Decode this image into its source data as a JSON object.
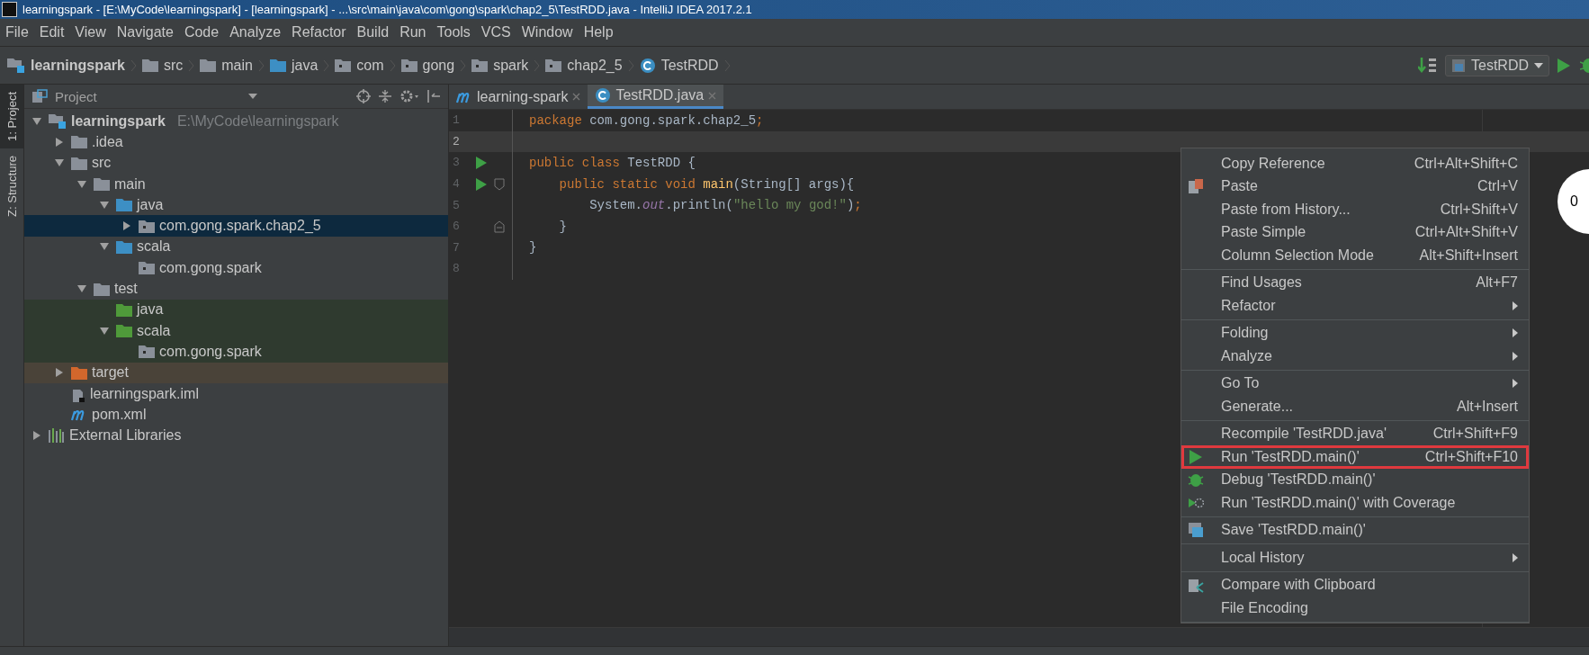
{
  "window": {
    "title": "learningspark - [E:\\MyCode\\learningspark] - [learningspark] - ...\\src\\main\\java\\com\\gong\\spark\\chap2_5\\TestRDD.java - IntelliJ IDEA 2017.2.1"
  },
  "menu": [
    "File",
    "Edit",
    "View",
    "Navigate",
    "Code",
    "Analyze",
    "Refactor",
    "Build",
    "Run",
    "Tools",
    "VCS",
    "Window",
    "Help"
  ],
  "breadcrumbs": [
    {
      "label": "learningspark",
      "kind": "module"
    },
    {
      "label": "src",
      "kind": "folder"
    },
    {
      "label": "main",
      "kind": "folder"
    },
    {
      "label": "java",
      "kind": "source"
    },
    {
      "label": "com",
      "kind": "package"
    },
    {
      "label": "gong",
      "kind": "package"
    },
    {
      "label": "spark",
      "kind": "package"
    },
    {
      "label": "chap2_5",
      "kind": "package"
    },
    {
      "label": "TestRDD",
      "kind": "class"
    }
  ],
  "run_config": {
    "label": "TestRDD"
  },
  "side_tabs": [
    {
      "label": "1: Project",
      "selected": true
    },
    {
      "label": "Z: Structure",
      "selected": false
    }
  ],
  "project_panel": {
    "title": "Project",
    "tree": [
      {
        "label": "learningspark",
        "path": "E:\\MyCode\\learningspark",
        "kind": "module",
        "expanded": true,
        "selected": false,
        "children": [
          {
            "label": ".idea",
            "kind": "folder",
            "expanded": false,
            "selected": false
          },
          {
            "label": "src",
            "kind": "folder",
            "expanded": true,
            "selected": false,
            "children": [
              {
                "label": "main",
                "kind": "folder",
                "expanded": true,
                "selected": false,
                "children": [
                  {
                    "label": "java",
                    "kind": "source",
                    "expanded": true,
                    "selected": false,
                    "children": [
                      {
                        "label": "com.gong.spark.chap2_5",
                        "kind": "package",
                        "expanded": false,
                        "selected": true
                      }
                    ]
                  },
                  {
                    "label": "scala",
                    "kind": "source",
                    "expanded": true,
                    "selected": false,
                    "children": [
                      {
                        "label": "com.gong.spark",
                        "kind": "package",
                        "selected": false
                      }
                    ]
                  }
                ]
              },
              {
                "label": "test",
                "kind": "folder",
                "expanded": true,
                "selected": false,
                "children": [
                  {
                    "label": "java",
                    "kind": "test",
                    "selected": false
                  },
                  {
                    "label": "scala",
                    "kind": "test",
                    "expanded": true,
                    "selected": false,
                    "children": [
                      {
                        "label": "com.gong.spark",
                        "kind": "package",
                        "selected": false
                      }
                    ]
                  }
                ]
              }
            ]
          },
          {
            "label": "target",
            "kind": "excluded",
            "expanded": false,
            "selected": false
          },
          {
            "label": "learningspark.iml",
            "kind": "iml",
            "selected": false
          },
          {
            "label": "pom.xml",
            "kind": "maven",
            "selected": false
          }
        ]
      },
      {
        "label": "External Libraries",
        "kind": "libraries",
        "expanded": false,
        "selected": false
      }
    ]
  },
  "editor_tabs": [
    {
      "label": "learning-spark",
      "kind": "maven",
      "selected": false
    },
    {
      "label": "TestRDD.java",
      "kind": "class",
      "selected": true
    }
  ],
  "code": [
    {
      "number": "1",
      "current": false,
      "run": false,
      "fold_start": false,
      "fold_end": false,
      "tokens": [
        {
          "kind": "kw",
          "t": "package"
        },
        {
          "kind": "plain",
          "t": " com.gong.spark.chap2_5"
        },
        {
          "kind": "kw",
          "t": ";"
        }
      ]
    },
    {
      "number": "2",
      "current": true,
      "run": false,
      "fold_start": false,
      "fold_end": false
    },
    {
      "number": "3",
      "current": false,
      "run": true,
      "fold_start": false,
      "fold_end": false,
      "tokens": [
        {
          "kind": "kw",
          "t": "public class"
        },
        {
          "kind": "plain",
          "t": " TestRDD {"
        }
      ]
    },
    {
      "number": "4",
      "current": false,
      "run": true,
      "fold_start": true,
      "fold_end": false,
      "tokens": [
        {
          "kind": "kw",
          "t": "    public static void "
        },
        {
          "kind": "fn",
          "t": "main"
        },
        {
          "kind": "plain",
          "t": "(String[] args){"
        }
      ]
    },
    {
      "number": "5",
      "current": false,
      "run": false,
      "fold_start": false,
      "fold_end": false,
      "tokens": [
        {
          "kind": "plain",
          "t": "        System."
        },
        {
          "kind": "field",
          "t": "out"
        },
        {
          "kind": "plain",
          "t": ".println("
        },
        {
          "kind": "str",
          "t": "\"hello my god!\""
        },
        {
          "kind": "plain",
          "t": ")"
        },
        {
          "kind": "kw",
          "t": ";"
        }
      ]
    },
    {
      "number": "6",
      "current": false,
      "run": false,
      "fold_start": false,
      "fold_end": true,
      "tokens": [
        {
          "kind": "plain",
          "t": "    }"
        }
      ]
    },
    {
      "number": "7",
      "current": false,
      "run": false,
      "fold_start": false,
      "fold_end": false,
      "tokens": [
        {
          "kind": "plain",
          "t": "}"
        }
      ]
    },
    {
      "number": "8",
      "current": false,
      "run": false,
      "fold_start": false,
      "fold_end": false
    }
  ],
  "memory_indicator": {
    "text": "0"
  },
  "context_menu": {
    "groups": [
      [
        {
          "label": "Copy Reference",
          "shortcut": "Ctrl+Alt+Shift+C",
          "submenu": false,
          "annotated": false
        },
        {
          "label": "Paste",
          "shortcut": "Ctrl+V",
          "kind": "paste",
          "submenu": false,
          "annotated": false
        },
        {
          "label": "Paste from History...",
          "shortcut": "Ctrl+Shift+V",
          "submenu": false,
          "annotated": false
        },
        {
          "label": "Paste Simple",
          "shortcut": "Ctrl+Alt+Shift+V",
          "submenu": false,
          "annotated": false
        },
        {
          "label": "Column Selection Mode",
          "shortcut": "Alt+Shift+Insert",
          "submenu": false,
          "annotated": false
        }
      ],
      [
        {
          "label": "Find Usages",
          "shortcut": "Alt+F7",
          "submenu": false,
          "annotated": false
        },
        {
          "label": "Refactor",
          "submenu": true,
          "annotated": false
        }
      ],
      [
        {
          "label": "Folding",
          "submenu": true,
          "annotated": false
        },
        {
          "label": "Analyze",
          "submenu": true,
          "annotated": false
        }
      ],
      [
        {
          "label": "Go To",
          "submenu": true,
          "annotated": false
        },
        {
          "label": "Generate...",
          "shortcut": "Alt+Insert",
          "submenu": false,
          "annotated": false
        }
      ],
      [
        {
          "label": "Recompile 'TestRDD.java'",
          "shortcut": "Ctrl+Shift+F9",
          "submenu": false,
          "annotated": false
        },
        {
          "label": "Run 'TestRDD.main()'",
          "shortcut": "Ctrl+Shift+F10",
          "kind": "run",
          "submenu": false,
          "annotated": true
        },
        {
          "label": "Debug 'TestRDD.main()'",
          "kind": "debug",
          "submenu": false,
          "annotated": false
        },
        {
          "label": "Run 'TestRDD.main()' with Coverage",
          "kind": "coverage",
          "submenu": false,
          "annotated": false
        }
      ],
      [
        {
          "label": "Save 'TestRDD.main()'",
          "kind": "save",
          "submenu": false,
          "annotated": false
        }
      ],
      [
        {
          "label": "Local History",
          "submenu": true,
          "annotated": false
        }
      ],
      [
        {
          "label": "Compare with Clipboard",
          "kind": "compare",
          "submenu": false,
          "annotated": false
        },
        {
          "label": "File Encoding",
          "submenu": false,
          "annotated": false
        }
      ]
    ]
  }
}
